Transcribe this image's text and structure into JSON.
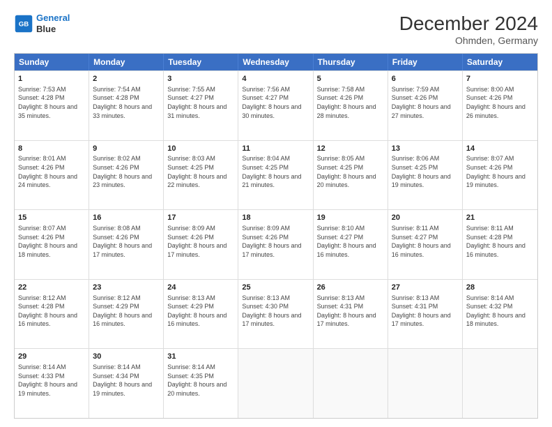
{
  "header": {
    "logo_line1": "General",
    "logo_line2": "Blue",
    "title": "December 2024",
    "subtitle": "Ohmden, Germany"
  },
  "days": [
    "Sunday",
    "Monday",
    "Tuesday",
    "Wednesday",
    "Thursday",
    "Friday",
    "Saturday"
  ],
  "weeks": [
    [
      {
        "day": "1",
        "sunrise": "7:53 AM",
        "sunset": "4:28 PM",
        "daylight": "8 hours and 35 minutes."
      },
      {
        "day": "2",
        "sunrise": "7:54 AM",
        "sunset": "4:28 PM",
        "daylight": "8 hours and 33 minutes."
      },
      {
        "day": "3",
        "sunrise": "7:55 AM",
        "sunset": "4:27 PM",
        "daylight": "8 hours and 31 minutes."
      },
      {
        "day": "4",
        "sunrise": "7:56 AM",
        "sunset": "4:27 PM",
        "daylight": "8 hours and 30 minutes."
      },
      {
        "day": "5",
        "sunrise": "7:58 AM",
        "sunset": "4:26 PM",
        "daylight": "8 hours and 28 minutes."
      },
      {
        "day": "6",
        "sunrise": "7:59 AM",
        "sunset": "4:26 PM",
        "daylight": "8 hours and 27 minutes."
      },
      {
        "day": "7",
        "sunrise": "8:00 AM",
        "sunset": "4:26 PM",
        "daylight": "8 hours and 26 minutes."
      }
    ],
    [
      {
        "day": "8",
        "sunrise": "8:01 AM",
        "sunset": "4:26 PM",
        "daylight": "8 hours and 24 minutes."
      },
      {
        "day": "9",
        "sunrise": "8:02 AM",
        "sunset": "4:26 PM",
        "daylight": "8 hours and 23 minutes."
      },
      {
        "day": "10",
        "sunrise": "8:03 AM",
        "sunset": "4:25 PM",
        "daylight": "8 hours and 22 minutes."
      },
      {
        "day": "11",
        "sunrise": "8:04 AM",
        "sunset": "4:25 PM",
        "daylight": "8 hours and 21 minutes."
      },
      {
        "day": "12",
        "sunrise": "8:05 AM",
        "sunset": "4:25 PM",
        "daylight": "8 hours and 20 minutes."
      },
      {
        "day": "13",
        "sunrise": "8:06 AM",
        "sunset": "4:25 PM",
        "daylight": "8 hours and 19 minutes."
      },
      {
        "day": "14",
        "sunrise": "8:07 AM",
        "sunset": "4:26 PM",
        "daylight": "8 hours and 19 minutes."
      }
    ],
    [
      {
        "day": "15",
        "sunrise": "8:07 AM",
        "sunset": "4:26 PM",
        "daylight": "8 hours and 18 minutes."
      },
      {
        "day": "16",
        "sunrise": "8:08 AM",
        "sunset": "4:26 PM",
        "daylight": "8 hours and 17 minutes."
      },
      {
        "day": "17",
        "sunrise": "8:09 AM",
        "sunset": "4:26 PM",
        "daylight": "8 hours and 17 minutes."
      },
      {
        "day": "18",
        "sunrise": "8:09 AM",
        "sunset": "4:26 PM",
        "daylight": "8 hours and 17 minutes."
      },
      {
        "day": "19",
        "sunrise": "8:10 AM",
        "sunset": "4:27 PM",
        "daylight": "8 hours and 16 minutes."
      },
      {
        "day": "20",
        "sunrise": "8:11 AM",
        "sunset": "4:27 PM",
        "daylight": "8 hours and 16 minutes."
      },
      {
        "day": "21",
        "sunrise": "8:11 AM",
        "sunset": "4:28 PM",
        "daylight": "8 hours and 16 minutes."
      }
    ],
    [
      {
        "day": "22",
        "sunrise": "8:12 AM",
        "sunset": "4:28 PM",
        "daylight": "8 hours and 16 minutes."
      },
      {
        "day": "23",
        "sunrise": "8:12 AM",
        "sunset": "4:29 PM",
        "daylight": "8 hours and 16 minutes."
      },
      {
        "day": "24",
        "sunrise": "8:13 AM",
        "sunset": "4:29 PM",
        "daylight": "8 hours and 16 minutes."
      },
      {
        "day": "25",
        "sunrise": "8:13 AM",
        "sunset": "4:30 PM",
        "daylight": "8 hours and 17 minutes."
      },
      {
        "day": "26",
        "sunrise": "8:13 AM",
        "sunset": "4:31 PM",
        "daylight": "8 hours and 17 minutes."
      },
      {
        "day": "27",
        "sunrise": "8:13 AM",
        "sunset": "4:31 PM",
        "daylight": "8 hours and 17 minutes."
      },
      {
        "day": "28",
        "sunrise": "8:14 AM",
        "sunset": "4:32 PM",
        "daylight": "8 hours and 18 minutes."
      }
    ],
    [
      {
        "day": "29",
        "sunrise": "8:14 AM",
        "sunset": "4:33 PM",
        "daylight": "8 hours and 19 minutes."
      },
      {
        "day": "30",
        "sunrise": "8:14 AM",
        "sunset": "4:34 PM",
        "daylight": "8 hours and 19 minutes."
      },
      {
        "day": "31",
        "sunrise": "8:14 AM",
        "sunset": "4:35 PM",
        "daylight": "8 hours and 20 minutes."
      },
      null,
      null,
      null,
      null
    ]
  ]
}
